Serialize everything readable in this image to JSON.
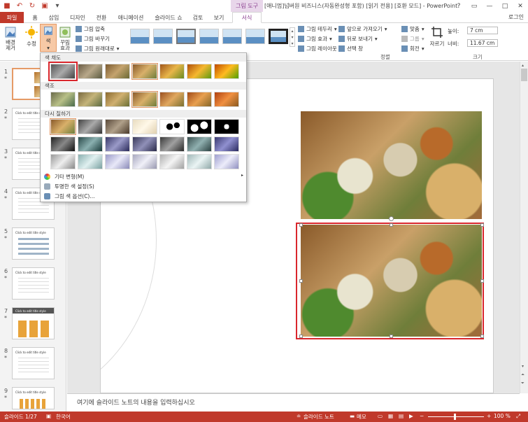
{
  "titlebar": {
    "context_tab": "그림 도구",
    "title": "[애니멈]넘버원 비즈니스(자동완성형 포함) [읽기 전용] [호환 모드] - PowerPoint",
    "help": "?",
    "restore": "▭",
    "minimize": "—",
    "maximize": "□",
    "close": "✕",
    "user": "로그인"
  },
  "tabs": [
    "파일",
    "홈",
    "삽입",
    "디자인",
    "전환",
    "애니메이션",
    "슬라이드 쇼",
    "검토",
    "보기",
    "서식"
  ],
  "ribbon": {
    "remove_bg": "배경\n제거",
    "correct": "수정",
    "color": "색",
    "artistic": "꾸밈\n효과",
    "compress": "그림 압축",
    "change": "그림 바꾸기",
    "reset": "그림 원래대로",
    "border": "그림 테두리",
    "effects": "그림 효과",
    "layout": "그림 레이아웃",
    "bring_forward": "앞으로 가져오기",
    "send_backward": "뒤로 보내기",
    "selection_pane": "선택 창",
    "align": "맞춤",
    "group": "그룹",
    "rotate": "회전",
    "crop": "자르기",
    "height_label": "높이:",
    "height_value": "7 cm",
    "width_label": "너비:",
    "width_value": "11.67 cm",
    "group_arrange": "정렬",
    "group_size": "크기"
  },
  "dropdown": {
    "saturation": "색 채도",
    "tone": "색조",
    "recolor": "다시 칠하기",
    "more_variations": "기타 변형(M)",
    "set_transparent": "투명한 색 설정(S)",
    "color_options": "그림 색 옵션(C)..."
  },
  "slides": [
    {
      "num": "1",
      "title": ""
    },
    {
      "num": "2",
      "title": "Click to edit title style"
    },
    {
      "num": "3",
      "title": "Click to edit title style"
    },
    {
      "num": "4",
      "title": "Click to edit title style"
    },
    {
      "num": "5",
      "title": "Click to edit title style"
    },
    {
      "num": "6",
      "title": "Click to edit title style"
    },
    {
      "num": "7",
      "title": "Click to edit title style"
    },
    {
      "num": "8",
      "title": "Click to edit title style"
    },
    {
      "num": "9",
      "title": "Click to edit title style"
    }
  ],
  "notes_placeholder": "여기에 슬라이드 노트의 내용을 입력하십시오",
  "status": {
    "slide": "슬라이드 1/27",
    "language": "한국어",
    "notes": "슬라이드 노트",
    "comments": "메모",
    "zoom": "100 %"
  }
}
